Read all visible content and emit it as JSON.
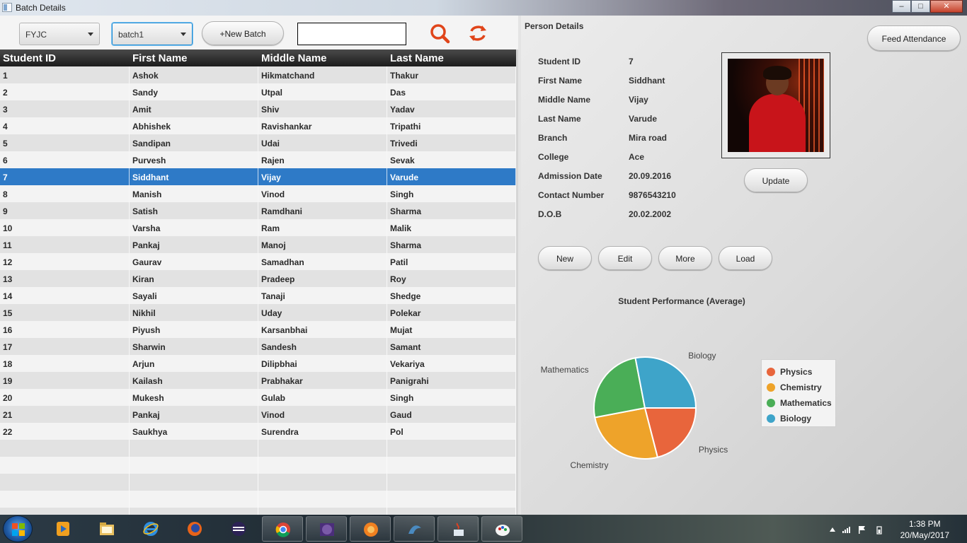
{
  "window": {
    "title": "Batch Details",
    "controls": {
      "minimize": "–",
      "maximize": "□",
      "close": "✕"
    }
  },
  "toolbar": {
    "class_combo": "FYJC",
    "batch_combo": "batch1",
    "new_batch_label": "+New Batch",
    "search_value": "",
    "search_icon": "search-icon",
    "refresh_icon": "refresh-icon",
    "accent_color": "#e0451a"
  },
  "table": {
    "columns": [
      "Student ID",
      "First Name",
      "Middle Name",
      "Last Name"
    ],
    "selected_id": "7",
    "rows": [
      [
        "1",
        "Ashok",
        "Hikmatchand",
        "Thakur"
      ],
      [
        "2",
        "Sandy",
        "Utpal",
        "Das"
      ],
      [
        "3",
        "Amit",
        "Shiv",
        "Yadav"
      ],
      [
        "4",
        "Abhishek",
        "Ravishankar",
        "Tripathi"
      ],
      [
        "5",
        "Sandipan",
        "Udai",
        "Trivedi"
      ],
      [
        "6",
        "Purvesh",
        "Rajen",
        "Sevak"
      ],
      [
        "7",
        "Siddhant",
        "Vijay",
        "Varude"
      ],
      [
        "8",
        "Manish",
        "Vinod",
        "Singh"
      ],
      [
        "9",
        "Satish",
        "Ramdhani",
        "Sharma"
      ],
      [
        "10",
        "Varsha",
        "Ram",
        "Malik"
      ],
      [
        "11",
        "Pankaj",
        "Manoj",
        "Sharma"
      ],
      [
        "12",
        "Gaurav",
        "Samadhan",
        "Patil"
      ],
      [
        "13",
        "Kiran",
        "Pradeep",
        "Roy"
      ],
      [
        "14",
        "Sayali",
        "Tanaji",
        "Shedge"
      ],
      [
        "15",
        "Nikhil",
        "Uday",
        "Polekar"
      ],
      [
        "16",
        "Piyush",
        "Karsanbhai",
        "Mujat"
      ],
      [
        "17",
        "Sharwin",
        "Sandesh",
        "Samant"
      ],
      [
        "18",
        "Arjun",
        "Dilipbhai",
        "Vekariya"
      ],
      [
        "19",
        "Kailash",
        "Prabhakar",
        "Panigrahi"
      ],
      [
        "20",
        "Mukesh",
        "Gulab",
        "Singh"
      ],
      [
        "21",
        "Pankaj",
        "Vinod",
        "Gaud"
      ],
      [
        "22",
        "Saukhya",
        "Surendra",
        "Pol"
      ]
    ],
    "empty_rows": 5
  },
  "person": {
    "section_title": "Person Details",
    "feed_attendance_label": "Feed Attendance",
    "update_label": "Update",
    "fields": [
      {
        "label": "Student ID",
        "value": "7"
      },
      {
        "label": "First Name",
        "value": "Siddhant"
      },
      {
        "label": "Middle Name",
        "value": "Vijay"
      },
      {
        "label": "Last Name",
        "value": "Varude"
      },
      {
        "label": "Branch",
        "value": "Mira road"
      },
      {
        "label": "College",
        "value": "Ace"
      },
      {
        "label": "Admission Date",
        "value": "20.09.2016"
      },
      {
        "label": "Contact Number",
        "value": "9876543210"
      },
      {
        "label": "D.O.B",
        "value": "20.02.2002"
      }
    ],
    "actions": [
      "New",
      "Edit",
      "More",
      "Load"
    ]
  },
  "chart_data": {
    "type": "pie",
    "title": "Student Performance (Average)",
    "categories": [
      "Physics",
      "Chemistry",
      "Mathematics",
      "Biology"
    ],
    "values": [
      21,
      26,
      25,
      28
    ],
    "colors": [
      "#e8653c",
      "#eea32a",
      "#4aae57",
      "#3ea4c9"
    ],
    "legend_position": "right"
  },
  "taskbar": {
    "apps": [
      {
        "name": "windows-media-player",
        "pinned": false
      },
      {
        "name": "file-explorer",
        "pinned": false
      },
      {
        "name": "internet-explorer",
        "pinned": false
      },
      {
        "name": "firefox",
        "pinned": false
      },
      {
        "name": "eclipse",
        "pinned": false
      },
      {
        "name": "chrome",
        "pinned": true
      },
      {
        "name": "java-ee-ide",
        "pinned": true,
        "label": "Java EE IDE"
      },
      {
        "name": "app-orange",
        "pinned": true
      },
      {
        "name": "mysql-workbench",
        "pinned": true
      },
      {
        "name": "java",
        "pinned": true
      },
      {
        "name": "paint",
        "pinned": true
      }
    ],
    "time": "1:38 PM",
    "date": "20/May/2017"
  }
}
